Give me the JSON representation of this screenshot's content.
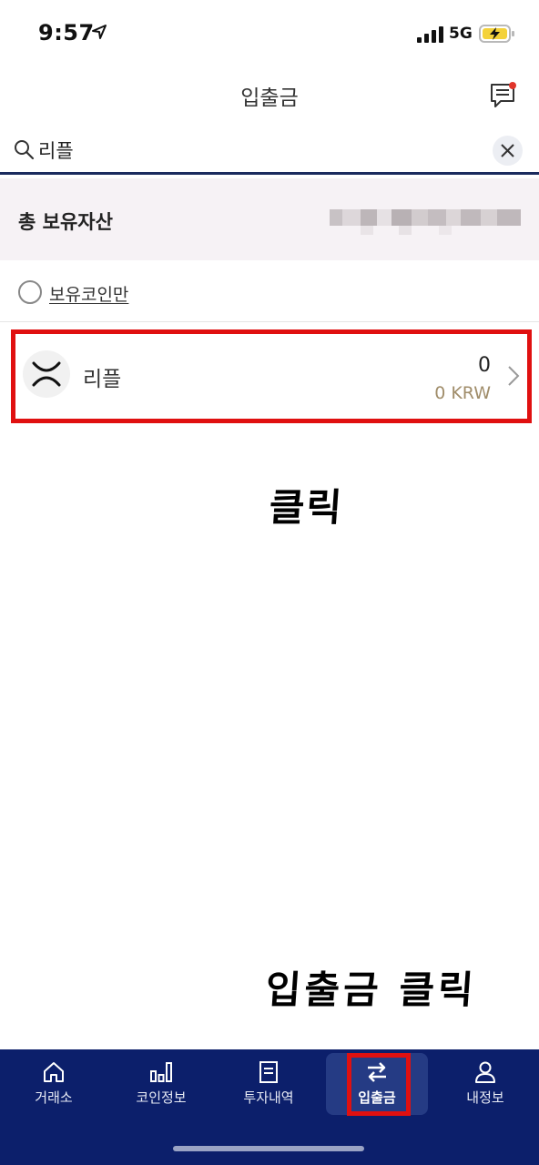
{
  "status_bar": {
    "time": "9:57",
    "network": "5G"
  },
  "header": {
    "title": "입출금"
  },
  "search": {
    "value": "리플",
    "placeholder": ""
  },
  "assets": {
    "label": "총 보유자산"
  },
  "filter": {
    "owned_only_label": "보유코인만"
  },
  "coins": [
    {
      "name": "리플",
      "amount": "0",
      "krw": "0 KRW",
      "icon": "xrp-icon"
    }
  ],
  "annotations": {
    "click_row": "클릭",
    "click_tab": "입출금 클릭"
  },
  "nav": {
    "items": [
      {
        "label": "거래소",
        "icon": "home-icon"
      },
      {
        "label": "코인정보",
        "icon": "bar-chart-icon"
      },
      {
        "label": "투자내역",
        "icon": "document-icon"
      },
      {
        "label": "입출금",
        "icon": "transfer-icon",
        "active": true
      },
      {
        "label": "내정보",
        "icon": "person-icon"
      }
    ]
  },
  "colors": {
    "nav_bg": "#0c1f6b",
    "highlight": "#e01010",
    "accent_dot": "#e0352b",
    "krw_text": "#a08d6a"
  }
}
